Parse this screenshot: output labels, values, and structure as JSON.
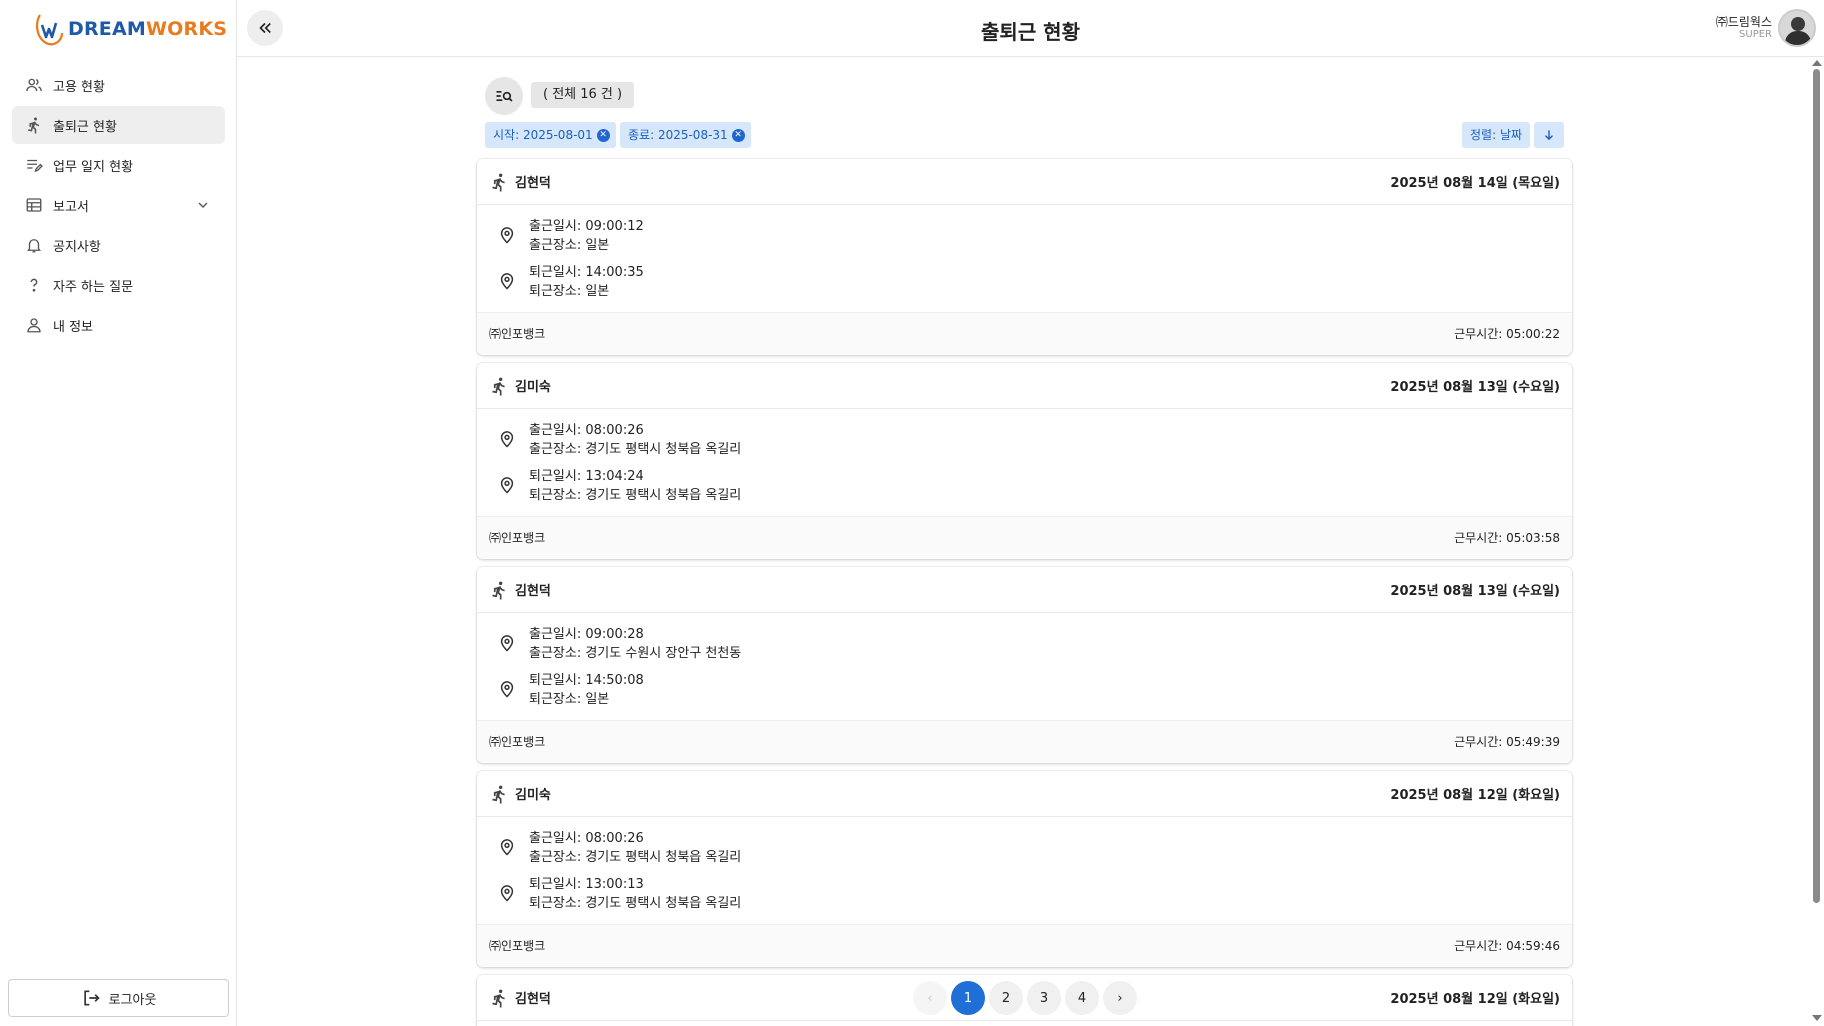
{
  "brand": {
    "logo_text_a": "DREAM",
    "logo_text_b": "WORKS"
  },
  "sidebar": {
    "items": [
      {
        "label": "고용 현황",
        "icon": "users-icon"
      },
      {
        "label": "출퇴근 현황",
        "icon": "running-icon",
        "active": true
      },
      {
        "label": "업무 일지 현황",
        "icon": "edit-list-icon"
      },
      {
        "label": "보고서",
        "icon": "table-icon",
        "has_children": true
      },
      {
        "label": "공지사항",
        "icon": "bell-icon"
      },
      {
        "label": "자주 하는 질문",
        "icon": "question-icon"
      },
      {
        "label": "내 정보",
        "icon": "person-icon"
      }
    ],
    "logout_label": "로그아웃"
  },
  "header": {
    "title": "출퇴근 현황",
    "user_name": "㈜드림웍스",
    "user_role": "SUPER"
  },
  "toolbar": {
    "total_label": "( 전체 16 건 )",
    "filters": [
      "시작: 2025-08-01",
      "종료: 2025-08-31"
    ],
    "sort_label": "정렬: 날짜"
  },
  "records": [
    {
      "name": "김현덕",
      "date": "2025년 08월 14일 (목요일)",
      "in_time": "출근일시: 09:00:12",
      "in_place": "출근장소: 일본",
      "out_time": "퇴근일시: 14:00:35",
      "out_place": "퇴근장소: 일본",
      "company": "㈜인포뱅크",
      "hours": "근무시간: 05:00:22"
    },
    {
      "name": "김미숙",
      "date": "2025년 08월 13일 (수요일)",
      "in_time": "출근일시: 08:00:26",
      "in_place": "출근장소: 경기도 평택시 청북읍 옥길리",
      "out_time": "퇴근일시: 13:04:24",
      "out_place": "퇴근장소: 경기도 평택시 청북읍 옥길리",
      "company": "㈜인포뱅크",
      "hours": "근무시간: 05:03:58"
    },
    {
      "name": "김현덕",
      "date": "2025년 08월 13일 (수요일)",
      "in_time": "출근일시: 09:00:28",
      "in_place": "출근장소: 경기도 수원시 장안구 천천동",
      "out_time": "퇴근일시: 14:50:08",
      "out_place": "퇴근장소: 일본",
      "company": "㈜인포뱅크",
      "hours": "근무시간: 05:49:39"
    },
    {
      "name": "김미숙",
      "date": "2025년 08월 12일 (화요일)",
      "in_time": "출근일시: 08:00:26",
      "in_place": "출근장소: 경기도 평택시 청북읍 옥길리",
      "out_time": "퇴근일시: 13:00:13",
      "out_place": "퇴근장소: 경기도 평택시 청북읍 옥길리",
      "company": "㈜인포뱅크",
      "hours": "근무시간: 04:59:46"
    },
    {
      "name": "김현덕",
      "date": "2025년 08월 12일 (화요일)"
    }
  ],
  "pagination": {
    "prev": "‹",
    "next": "›",
    "pages": [
      "1",
      "2",
      "3",
      "4"
    ],
    "current": "1"
  },
  "colors": {
    "accent": "#1f6fd6",
    "chip_bg": "#d6e7fb",
    "chip_text": "#1a5fc2"
  }
}
